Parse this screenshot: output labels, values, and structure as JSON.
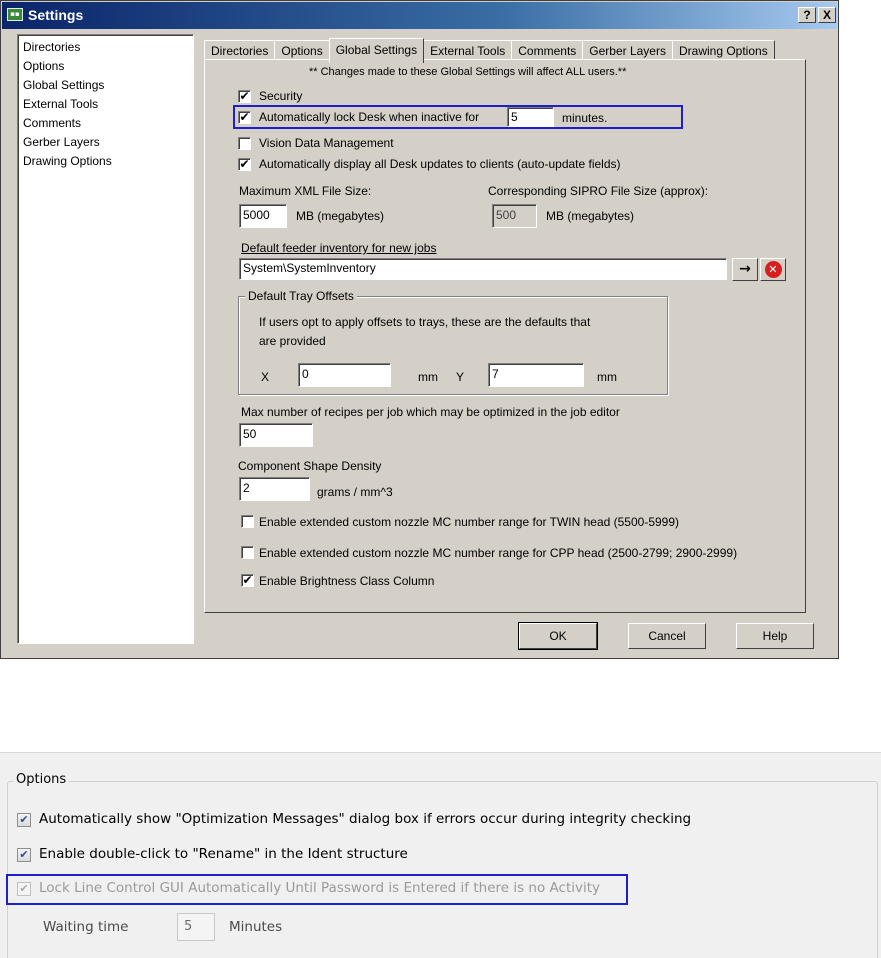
{
  "window": {
    "title": "Settings",
    "help_label": "?",
    "close_label": "X"
  },
  "sidebar": {
    "items": [
      {
        "label": "Directories"
      },
      {
        "label": "Options"
      },
      {
        "label": "Global Settings"
      },
      {
        "label": "External Tools"
      },
      {
        "label": "Comments"
      },
      {
        "label": "Gerber Layers"
      },
      {
        "label": "Drawing Options"
      }
    ]
  },
  "tabs": [
    {
      "label": "Directories"
    },
    {
      "label": "Options"
    },
    {
      "label": "Global Settings",
      "active": true
    },
    {
      "label": "External Tools"
    },
    {
      "label": "Comments"
    },
    {
      "label": "Gerber Layers"
    },
    {
      "label": "Drawing Options"
    }
  ],
  "global_settings": {
    "notice": "** Changes made to these Global Settings will affect ALL users.**",
    "security": {
      "label": "Security",
      "checked": true
    },
    "auto_lock": {
      "label": "Automatically lock Desk when inactive for",
      "checked": true,
      "value": "5",
      "unit": "minutes."
    },
    "vision_data": {
      "label": "Vision Data Management",
      "checked": false
    },
    "auto_display": {
      "label": "Automatically display all Desk updates to clients (auto-update fields)",
      "checked": true
    },
    "max_xml": {
      "label": "Maximum XML File Size:",
      "value": "5000",
      "unit": "MB (megabytes)"
    },
    "sipro": {
      "label": "Corresponding SIPRO File Size (approx):",
      "value": "500",
      "unit": "MB (megabytes)"
    },
    "feeder": {
      "label": "Default feeder inventory for new jobs",
      "value": "System\\SystemInventory",
      "go_label": "→",
      "clear_label": "✕"
    },
    "tray_offsets": {
      "title": "Default Tray Offsets",
      "description_line1": "If users opt to apply offsets to trays,  these are the defaults that",
      "description_line2": "are provided",
      "x_label": "X",
      "x_value": "0",
      "x_unit": "mm",
      "y_label": "Y",
      "y_value": "7",
      "y_unit": "mm"
    },
    "max_recipes": {
      "label": "Max number of recipes per job which may be optimized in the job editor",
      "value": "50"
    },
    "shape_density": {
      "label": "Component Shape Density",
      "value": "2",
      "unit": "grams / mm^3"
    },
    "twin_head": {
      "label": "Enable extended custom nozzle MC number range for TWIN head (5500-5999)",
      "checked": false
    },
    "cpp_head": {
      "label": "Enable extended custom nozzle MC number range for CPP head (2500-2799; 2900-2999)",
      "checked": false
    },
    "brightness": {
      "label": "Enable Brightness Class Column",
      "checked": true
    }
  },
  "buttons": {
    "ok": "OK",
    "cancel": "Cancel",
    "help": "Help"
  },
  "options_panel": {
    "title": "Options",
    "optimization_msgs": {
      "label": "Automatically show \"Optimization Messages\" dialog box if errors occur during integrity checking",
      "checked": true
    },
    "rename": {
      "label": "Enable double-click to \"Rename\" in the Ident structure",
      "checked": true
    },
    "lock_gui": {
      "label": "Lock Line Control GUI Automatically Until Password is Entered if there is no Activity",
      "checked": true,
      "disabled": true
    },
    "waiting": {
      "label": "Waiting time",
      "value": "5",
      "unit": "Minutes"
    }
  },
  "colors": {
    "highlight_box": "#1e1ecc",
    "titlebar": "#0a246a",
    "dialog_face": "#d4d0c8"
  },
  "icons": {
    "check": "✔",
    "app": "app-icon"
  }
}
